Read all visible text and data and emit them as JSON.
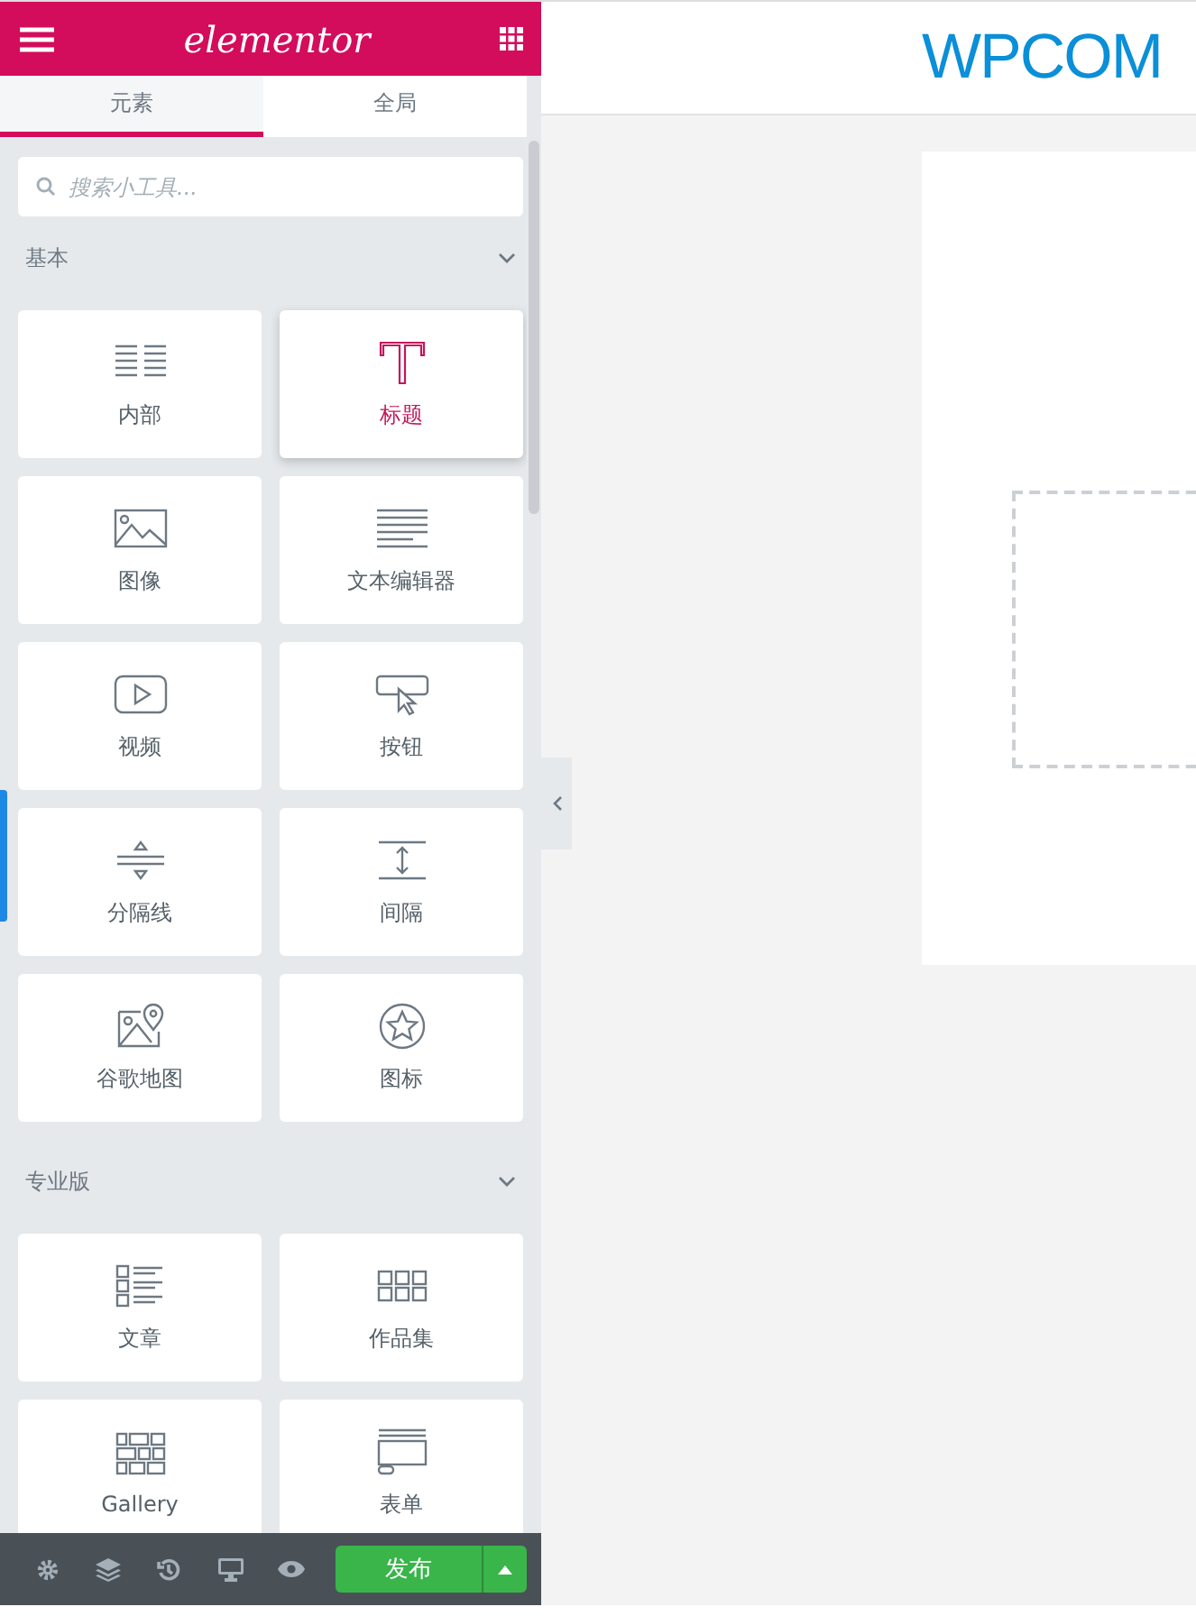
{
  "header": {
    "logo": "elementor"
  },
  "tabs": [
    {
      "label": "元素",
      "selected": true
    },
    {
      "label": "全局",
      "selected": false
    }
  ],
  "search": {
    "placeholder": "搜索小工具..."
  },
  "sections": [
    {
      "title": "基本",
      "expanded": true,
      "widgets": [
        {
          "kind": "inner-section",
          "label": "内部",
          "selected": false
        },
        {
          "kind": "heading",
          "label": "标题",
          "selected": true
        },
        {
          "kind": "image",
          "label": "图像",
          "selected": false
        },
        {
          "kind": "text-editor",
          "label": "文本编辑器",
          "selected": false
        },
        {
          "kind": "video",
          "label": "视频",
          "selected": false
        },
        {
          "kind": "button",
          "label": "按钮",
          "selected": false
        },
        {
          "kind": "divider",
          "label": "分隔线",
          "selected": false
        },
        {
          "kind": "spacer",
          "label": "间隔",
          "selected": false
        },
        {
          "kind": "map",
          "label": "谷歌地图",
          "selected": false
        },
        {
          "kind": "icon",
          "label": "图标",
          "selected": false
        }
      ]
    },
    {
      "title": "专业版",
      "expanded": true,
      "widgets": [
        {
          "kind": "posts",
          "label": "文章",
          "selected": false
        },
        {
          "kind": "portfolio",
          "label": "作品集",
          "selected": false
        },
        {
          "kind": "gallery",
          "label": "Gallery",
          "selected": false
        },
        {
          "kind": "form",
          "label": "表单",
          "selected": false
        }
      ]
    }
  ],
  "footer": {
    "publish": "发布"
  },
  "canvas": {
    "site_title": "WPCOM"
  }
}
